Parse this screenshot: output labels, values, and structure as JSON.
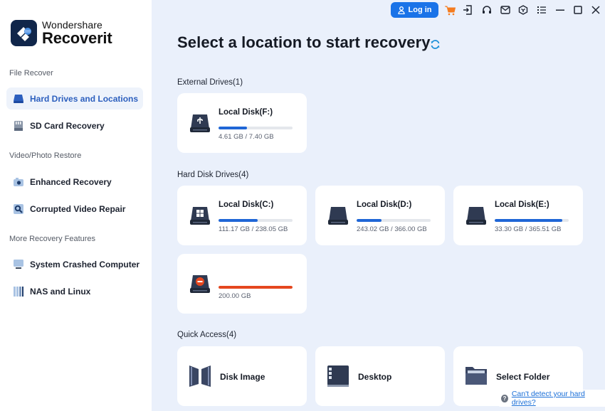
{
  "app": {
    "brand": "Wondershare",
    "product": "Recoverit"
  },
  "sidebar": {
    "sections": [
      {
        "label": "File Recover",
        "items": [
          {
            "label": "Hard Drives and Locations",
            "icon": "hard-drive-icon",
            "active": true
          },
          {
            "label": "SD Card Recovery",
            "icon": "sd-card-icon",
            "active": false
          }
        ]
      },
      {
        "label": "Video/Photo Restore",
        "items": [
          {
            "label": "Enhanced Recovery",
            "icon": "camera-icon",
            "active": false
          },
          {
            "label": "Corrupted Video Repair",
            "icon": "video-repair-icon",
            "active": false
          }
        ]
      },
      {
        "label": "More Recovery Features",
        "items": [
          {
            "label": "System Crashed Computer",
            "icon": "monitor-icon",
            "active": false
          },
          {
            "label": "NAS and Linux",
            "icon": "nas-icon",
            "active": false
          }
        ]
      }
    ]
  },
  "topbar": {
    "login_label": "Log in",
    "icons": [
      "cart-icon",
      "sign-in-icon",
      "headset-icon",
      "mail-icon",
      "cube-icon",
      "menu-list-icon",
      "minimize-icon",
      "maximize-icon",
      "close-icon"
    ]
  },
  "main": {
    "title": "Select a location to start recovery",
    "groups": {
      "external": {
        "label": "External Drives(1)",
        "drives": [
          {
            "name": "Local Disk(F:)",
            "size": "4.61 GB / 7.40 GB",
            "used_fraction": 0.38,
            "icon": "usb-drive-icon",
            "bar_color": "#1f66d6"
          }
        ]
      },
      "hard_disk": {
        "label": "Hard Disk Drives(4)",
        "drives": [
          {
            "name": "Local Disk(C:)",
            "size": "111.17 GB / 238.05 GB",
            "used_fraction": 0.53,
            "icon": "windows-drive-icon",
            "bar_color": "#1f66d6"
          },
          {
            "name": "Local Disk(D:)",
            "size": "243.02 GB / 366.00 GB",
            "used_fraction": 0.34,
            "icon": "drive-icon",
            "bar_color": "#1f66d6"
          },
          {
            "name": "Local Disk(E:)",
            "size": "33.30 GB / 365.51 GB",
            "used_fraction": 0.91,
            "icon": "drive-icon",
            "bar_color": "#1f66d6"
          },
          {
            "name": "",
            "size": "200.00 GB",
            "used_fraction": 1.0,
            "icon": "lost-partition-drive-icon",
            "bar_color": "#e5471f"
          }
        ]
      },
      "quick_access": {
        "label": "Quick Access(4)",
        "items": [
          {
            "label": "Disk Image",
            "icon": "disk-image-icon"
          },
          {
            "label": "Desktop",
            "icon": "desktop-icon"
          },
          {
            "label": "Select Folder",
            "icon": "folder-icon"
          }
        ]
      }
    },
    "help_link": "Can't detect your hard drives?"
  }
}
